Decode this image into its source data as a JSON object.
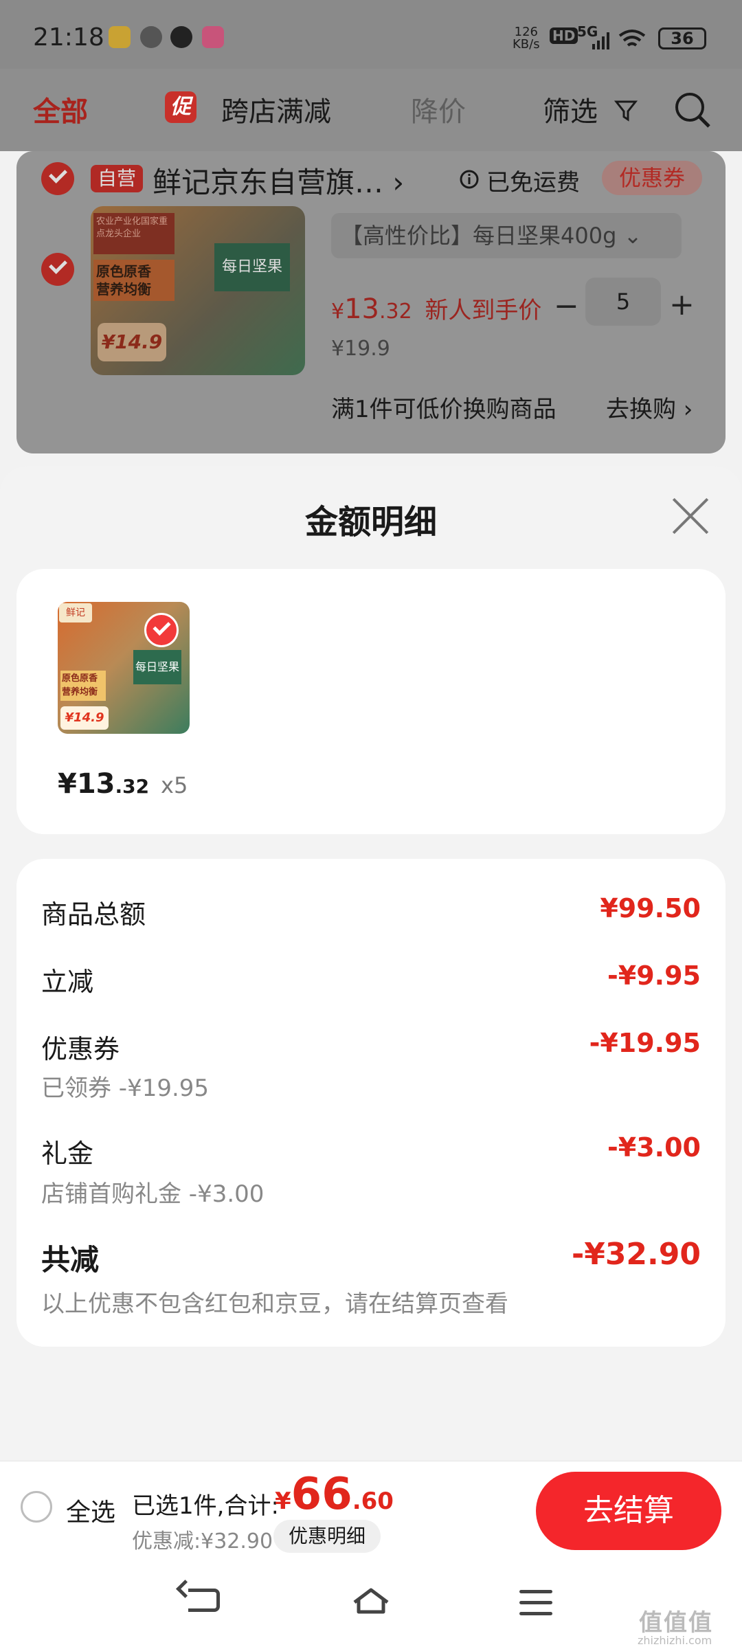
{
  "status_bar": {
    "time": "21:18",
    "net_speed_top": "126",
    "net_speed_unit": "KB/s",
    "hd": "HD",
    "signal": "5G",
    "battery": "36"
  },
  "top_tabs": {
    "all": "全部",
    "promo_badge": "促",
    "cross_shop": "跨店满减",
    "price_drop": "降价",
    "filter": "筛选"
  },
  "cart": {
    "self_operated": "自营",
    "shop_name": "鲜记京东自营旗…",
    "free_shipping": "已免运费",
    "coupon": "优惠券",
    "spec": "【高性价比】每日坚果400g",
    "price_symbol": "¥",
    "price_int": "13",
    "price_dec": ".32",
    "price_note": "新人到手价",
    "quantity": "5",
    "minus": "−",
    "plus": "+",
    "original_price": "¥19.9",
    "exchange_text": "满1件可低价换购商品",
    "exchange_link": "去换购"
  },
  "product_image": {
    "brand_text": "xianjee鲜记",
    "name_text": "每日坚果",
    "tag1": "原色原香",
    "tag2": "营养均衡",
    "badge_text": "农业产业化国家重点龙头企业",
    "price_text": "¥14.9"
  },
  "sheet": {
    "title": "金额明细",
    "item_price_int": "¥13",
    "item_price_dec": ".32",
    "item_qty": "x5",
    "rows": [
      {
        "label": "商品总额",
        "value": "¥99.50",
        "sub": ""
      },
      {
        "label": "立减",
        "value": "-¥9.95",
        "sub": ""
      },
      {
        "label": "优惠券",
        "value": "-¥19.95",
        "sub": "已领券 -¥19.95"
      },
      {
        "label": "礼金",
        "value": "-¥3.00",
        "sub": "店铺首购礼金 -¥3.00"
      }
    ],
    "total_label": "共减",
    "total_value": "-¥32.90",
    "total_note": "以上优惠不包含红包和京豆，请在结算页查看"
  },
  "bottom_bar": {
    "select_all": "全选",
    "selected_text": "已选1件,合计:",
    "total_symbol": "¥",
    "total_int": "66",
    "total_dec": ".60",
    "discount_text": "优惠减:¥32.90",
    "detail_button": "优惠明细",
    "checkout": "去结算"
  },
  "watermark": {
    "main": "值值值",
    "sub": "zhizhizhi.com"
  },
  "colors": {
    "accent": "#e1261c",
    "checkout": "#f4262b"
  }
}
